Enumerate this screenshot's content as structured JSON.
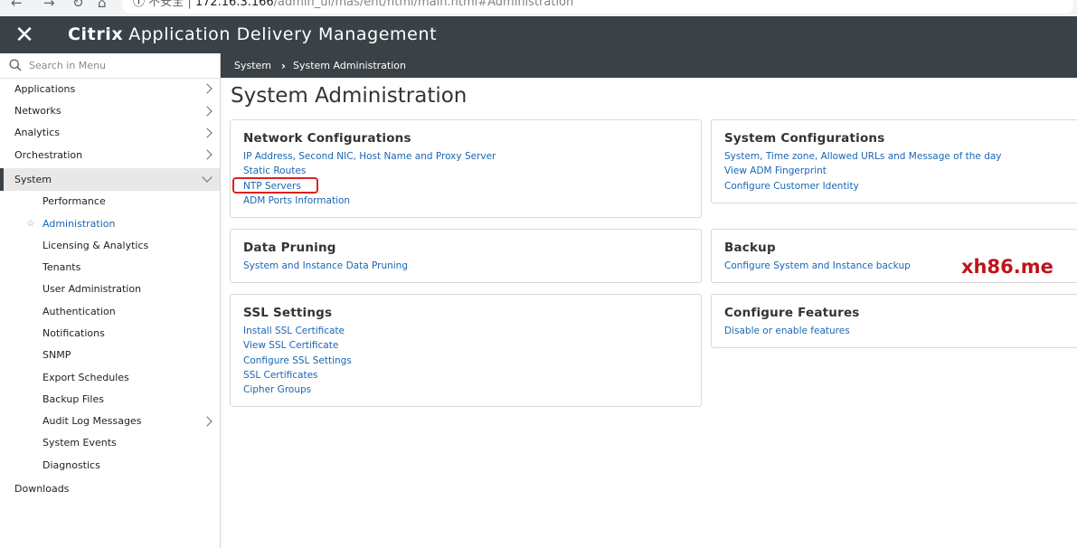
{
  "browser": {
    "url_security": "不安全",
    "url_host": "172.16.3.166",
    "url_path": "/admin_ui/mas/ent/html/main.html#Administration"
  },
  "header": {
    "brand": "Citrix",
    "product": "Application Delivery Management"
  },
  "search": {
    "placeholder": "Search in Menu"
  },
  "sidebar": {
    "top_items": [
      {
        "label": "Applications"
      },
      {
        "label": "Networks"
      },
      {
        "label": "Analytics"
      },
      {
        "label": "Orchestration"
      }
    ],
    "open_item": {
      "label": "System"
    },
    "sub_items": [
      {
        "label": "Performance"
      },
      {
        "label": "Administration"
      },
      {
        "label": "Licensing & Analytics"
      },
      {
        "label": "Tenants"
      },
      {
        "label": "User Administration"
      },
      {
        "label": "Authentication"
      },
      {
        "label": "Notifications"
      },
      {
        "label": "SNMP"
      },
      {
        "label": "Export Schedules"
      },
      {
        "label": "Backup Files"
      },
      {
        "label": "Audit Log Messages"
      },
      {
        "label": "System Events"
      },
      {
        "label": "Diagnostics"
      }
    ],
    "downloads": {
      "label": "Downloads"
    }
  },
  "breadcrumb": {
    "items": [
      "System",
      "System Administration"
    ]
  },
  "page": {
    "title": "System Administration"
  },
  "cards": {
    "network": {
      "title": "Network Configurations",
      "links": [
        "IP Address, Second NIC, Host Name and Proxy Server",
        "Static Routes",
        "NTP Servers",
        "ADM Ports Information"
      ]
    },
    "system_config": {
      "title": "System Configurations",
      "links": [
        "System, Time zone, Allowed URLs and Message of the day",
        "View ADM Fingerprint",
        "Configure Customer Identity"
      ]
    },
    "data_pruning": {
      "title": "Data Pruning",
      "links": [
        "System and Instance Data Pruning"
      ]
    },
    "backup": {
      "title": "Backup",
      "links": [
        "Configure System and Instance backup"
      ]
    },
    "ssl": {
      "title": "SSL Settings",
      "links": [
        "Install SSL Certificate",
        "View SSL Certificate",
        "Configure SSL Settings",
        "SSL Certificates",
        "Cipher Groups"
      ]
    },
    "features": {
      "title": "Configure Features",
      "links": [
        "Disable or enable features"
      ]
    }
  },
  "watermark": "xh86.me",
  "colors": {
    "header_bg": "#3b4247",
    "link": "#1a66b5",
    "highlight": "#e02020",
    "watermark": "#c0141c"
  }
}
